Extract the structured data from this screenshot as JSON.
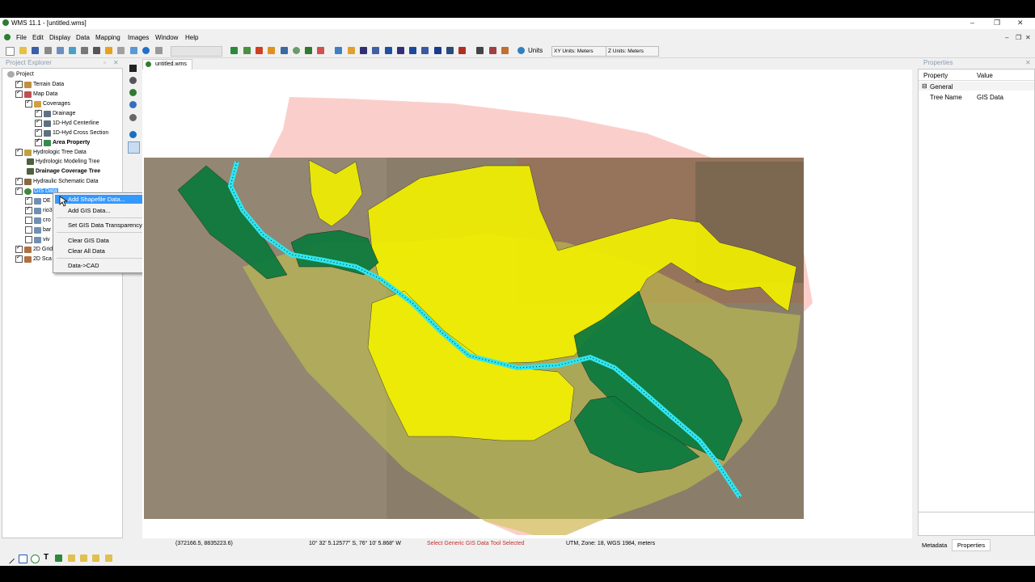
{
  "window": {
    "title": "WMS 11.1 - [untitled.wms]",
    "controls": [
      "–",
      "❐",
      "✕"
    ],
    "mdi_controls": [
      "–",
      "❐",
      "✕"
    ]
  },
  "menu": [
    "File",
    "Edit",
    "Display",
    "Data",
    "Mapping",
    "Images",
    "Window",
    "Help"
  ],
  "toolbar": {
    "units_label": "Units",
    "xy_units": "XY Units: Meters",
    "z_units": "Z Units: Meters"
  },
  "project_explorer": {
    "title": "Project Explorer",
    "items": [
      {
        "label": "Project"
      },
      {
        "label": "Terrain Data"
      },
      {
        "label": "Map Data"
      },
      {
        "label": "Coverages"
      },
      {
        "label": "Drainage"
      },
      {
        "label": "1D-Hyd Centerline"
      },
      {
        "label": "1D-Hyd Cross Section"
      },
      {
        "label": "Area Property"
      },
      {
        "label": "Hydrologic Tree Data"
      },
      {
        "label": "Hydrologic Modeling Tree"
      },
      {
        "label": "Drainage Coverage Tree"
      },
      {
        "label": "Hydraulic Schematic Data"
      },
      {
        "label": "GIS Data"
      },
      {
        "label": "DE"
      },
      {
        "label": "rio3"
      },
      {
        "label": "cro"
      },
      {
        "label": "bar"
      },
      {
        "label": "viv"
      },
      {
        "label": "2D Grid"
      },
      {
        "label": "2D Sca"
      }
    ]
  },
  "context_menu": {
    "items": [
      "Add Shapefile Data...",
      "Add GIS Data...",
      "Set GIS Data Transparency...",
      "Clear GIS Data",
      "Clear All Data",
      "Data->CAD"
    ]
  },
  "document_tab": "untitled.wms",
  "status_bar": {
    "coords": "(372166.5, 8835223.6)",
    "geo": "10° 32' 5.12577\" S, 76° 10' 5.868\" W",
    "message": "Select Generic GIS Data Tool Selected",
    "projection": "UTM,  Zone: 18,  WGS 1984,  meters"
  },
  "properties": {
    "title": "Properties",
    "col_property": "Property",
    "col_value": "Value",
    "group": "General",
    "row_name": "Tree Name",
    "row_value": "GIS Data"
  },
  "bottom_tabs": [
    "Metadata",
    "Properties"
  ],
  "colors": {
    "yellow_polygon": "#f2f000",
    "green_polygon": "#0e7a3e",
    "river": "#2ee6f0",
    "selection": "#3399ff"
  }
}
